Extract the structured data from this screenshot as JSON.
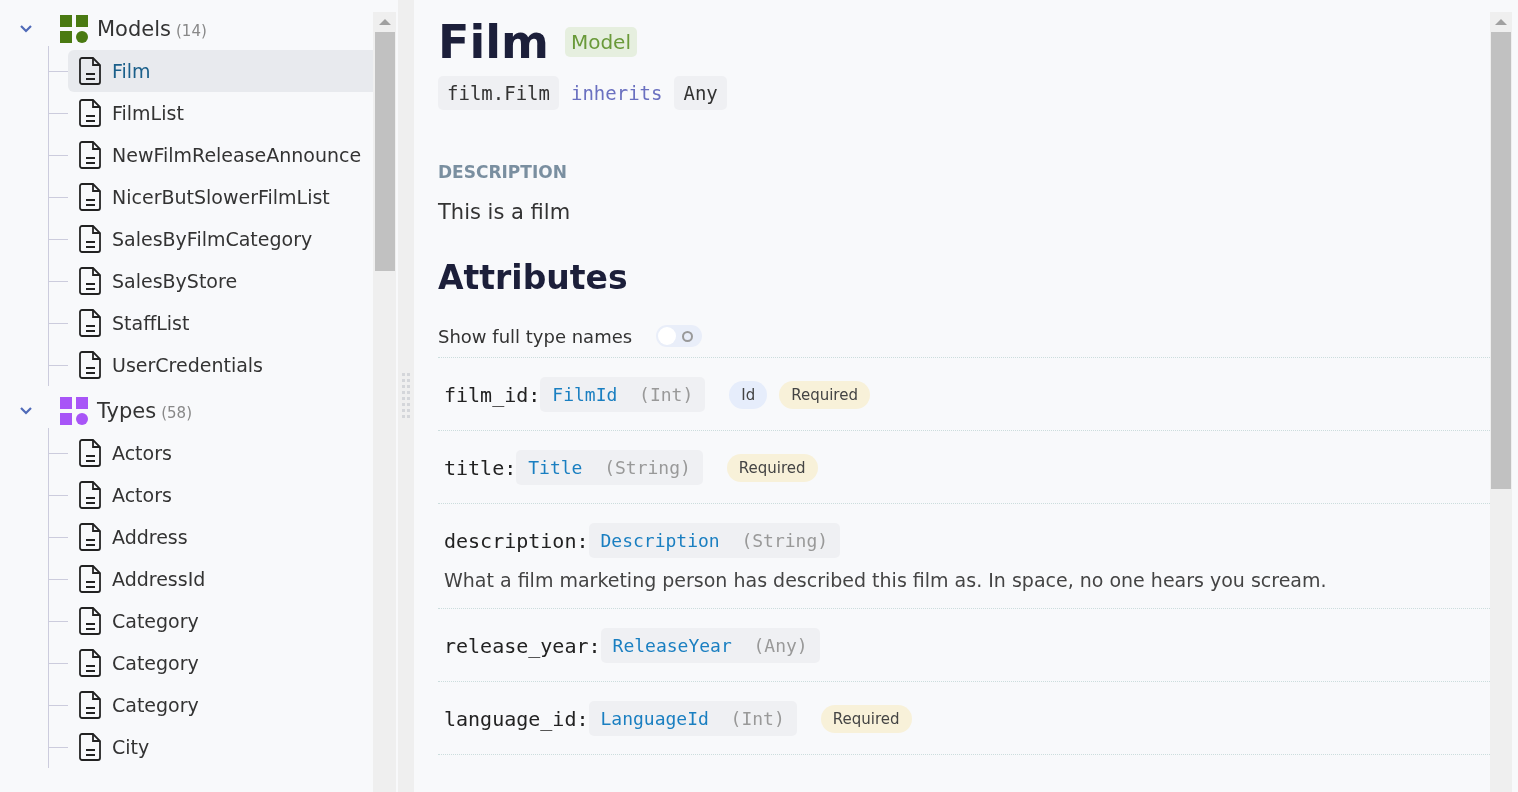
{
  "sidebar": {
    "groups": [
      {
        "label": "Models",
        "count": "(14)",
        "expanded": true,
        "color": "#4a7a12",
        "children": [
          {
            "label": "Film",
            "selected": true
          },
          {
            "label": "FilmList",
            "selected": false
          },
          {
            "label": "NewFilmReleaseAnnounce",
            "selected": false
          },
          {
            "label": "NicerButSlowerFilmList",
            "selected": false
          },
          {
            "label": "SalesByFilmCategory",
            "selected": false
          },
          {
            "label": "SalesByStore",
            "selected": false
          },
          {
            "label": "StaffList",
            "selected": false
          },
          {
            "label": "UserCredentials",
            "selected": false
          }
        ]
      },
      {
        "label": "Types",
        "count": "(58)",
        "expanded": true,
        "color": "#a855f7",
        "children": [
          {
            "label": "Actors",
            "selected": false
          },
          {
            "label": "Actors",
            "selected": false
          },
          {
            "label": "Address",
            "selected": false
          },
          {
            "label": "AddressId",
            "selected": false
          },
          {
            "label": "Category",
            "selected": false
          },
          {
            "label": "Category",
            "selected": false
          },
          {
            "label": "Category",
            "selected": false
          },
          {
            "label": "City",
            "selected": false
          }
        ]
      }
    ]
  },
  "header": {
    "title": "Film",
    "badge": "Model",
    "path": "film.Film",
    "inherits_label": "inherits",
    "inherits": "Any"
  },
  "description": {
    "heading": "DESCRIPTION",
    "text": "This is a film"
  },
  "attributes": {
    "heading": "Attributes",
    "toggle_label": "Show full type names",
    "toggle_on": false,
    "rows": [
      {
        "name": "film_id:",
        "type": "FilmId",
        "base": "(Int)",
        "tags": [
          {
            "label": "Id",
            "kind": "id"
          },
          {
            "label": "Required",
            "kind": "required"
          }
        ]
      },
      {
        "name": "title:",
        "type": "Title",
        "base": "(String)",
        "tags": [
          {
            "label": "Required",
            "kind": "required"
          }
        ]
      },
      {
        "name": "description:",
        "type": "Description",
        "base": "(String)",
        "tags": [],
        "text": "What a film marketing person has described this film as. In space, no one hears you scream."
      },
      {
        "name": "release_year:",
        "type": "ReleaseYear",
        "base": "(Any)",
        "tags": []
      },
      {
        "name": "language_id:",
        "type": "LanguageId",
        "base": "(Int)",
        "tags": [
          {
            "label": "Required",
            "kind": "required"
          }
        ]
      }
    ]
  }
}
